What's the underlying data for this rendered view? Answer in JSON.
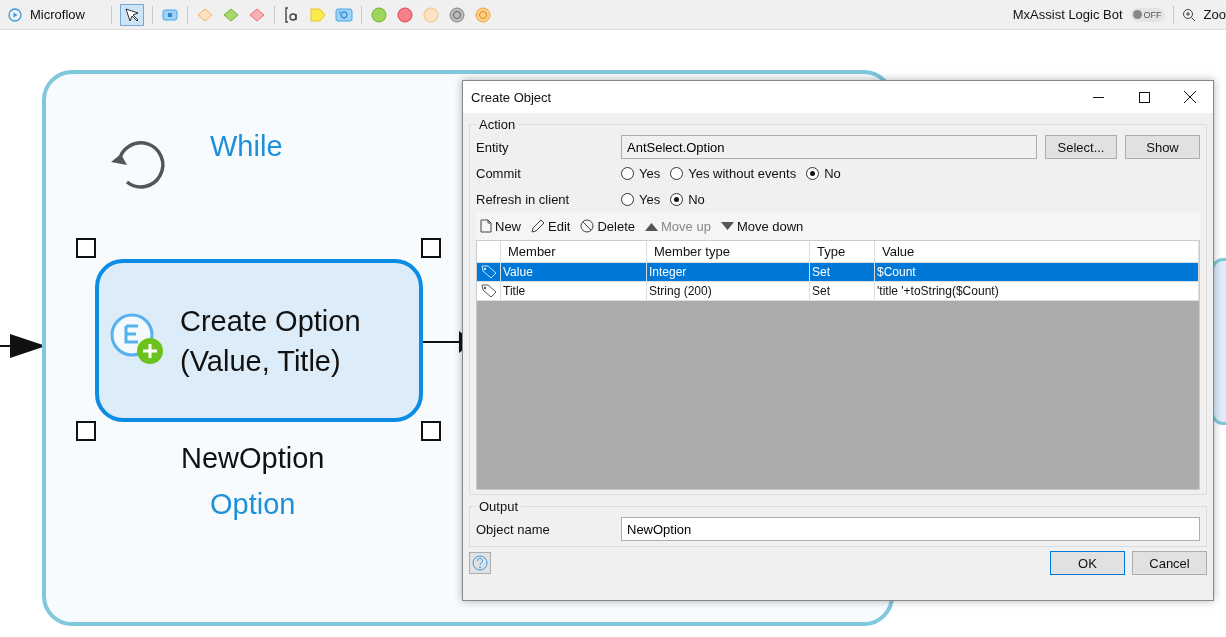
{
  "toolbar": {
    "title": "Microflow",
    "pointer_selected": true,
    "assist_label": "MxAssist Logic Bot",
    "toggle_label": "OFF",
    "toggle_on": false,
    "zoom_label": "Zoo"
  },
  "canvas": {
    "loop": {
      "label": "While"
    },
    "activity": {
      "lines": [
        "Create Option",
        "(Value, Title)"
      ],
      "selected": true,
      "output": "NewOption",
      "entity": "Option"
    }
  },
  "dialog": {
    "title": "Create Object",
    "action": {
      "legend": "Action",
      "entity_label": "Entity",
      "entity_value": "AntSelect.Option",
      "select_button": "Select...",
      "show_button": "Show",
      "commit": {
        "label": "Commit",
        "options": [
          {
            "label": "Yes",
            "selected": false
          },
          {
            "label": "Yes without events",
            "selected": false
          },
          {
            "label": "No",
            "selected": true
          }
        ]
      },
      "refresh": {
        "label": "Refresh in client",
        "options": [
          {
            "label": "Yes",
            "selected": false
          },
          {
            "label": "No",
            "selected": true
          }
        ]
      },
      "list_tools": [
        {
          "kind": "new",
          "label": "New",
          "disabled": false
        },
        {
          "kind": "edit",
          "label": "Edit",
          "disabled": false
        },
        {
          "kind": "delete",
          "label": "Delete",
          "disabled": false
        },
        {
          "kind": "up",
          "label": "Move up",
          "disabled": true
        },
        {
          "kind": "down",
          "label": "Move down",
          "disabled": false
        }
      ],
      "columns": [
        "Member",
        "Member type",
        "Type",
        "Value"
      ],
      "rows": [
        {
          "member": "Value",
          "member_type": "Integer",
          "type": "Set",
          "value": "$Count",
          "selected": true
        },
        {
          "member": "Title",
          "member_type": "String (200)",
          "type": "Set",
          "value": "'title '+toString($Count)",
          "selected": false
        }
      ]
    },
    "output": {
      "legend": "Output",
      "name_label": "Object name",
      "name_value": "NewOption"
    },
    "ok_button": "OK",
    "cancel_button": "Cancel"
  }
}
